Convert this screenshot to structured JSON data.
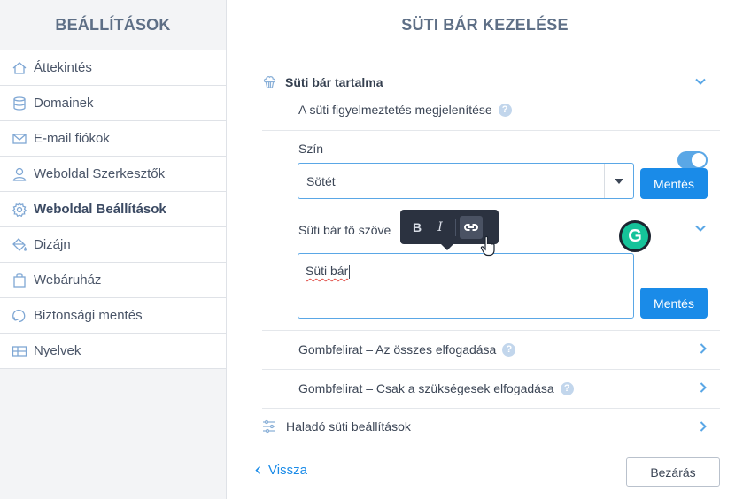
{
  "sidebar": {
    "title": "BEÁLLÍTÁSOK",
    "items": [
      {
        "label": "Áttekintés",
        "icon": "home-icon"
      },
      {
        "label": "Domainek",
        "icon": "database-icon"
      },
      {
        "label": "E-mail fiókok",
        "icon": "mail-icon"
      },
      {
        "label": "Weboldal Szerkesztők",
        "icon": "user-icon"
      },
      {
        "label": "Weboldal Beállítások",
        "icon": "gear-icon",
        "active": true
      },
      {
        "label": "Dizájn",
        "icon": "paint-bucket-icon"
      },
      {
        "label": "Webáruház",
        "icon": "shopping-bag-icon"
      },
      {
        "label": "Biztonsági mentés",
        "icon": "backup-icon"
      },
      {
        "label": "Nyelvek",
        "icon": "flag-icon"
      }
    ]
  },
  "main": {
    "title": "SÜTI BÁR KEZELÉSE",
    "section_title": "Süti bár tartalma",
    "show_warning_label": "A süti figyelmeztetés megjelenítése",
    "show_warning_enabled": true,
    "color_label": "Szín",
    "color_value": "Sötét",
    "save_label": "Mentés",
    "main_text_label": "Süti bár fő szöve",
    "main_text_value": "Süti bár",
    "toolbar": {
      "bold": "B",
      "italic": "I"
    },
    "grammarly_letter": "G",
    "button_accept_all_label": "Gombfelirat – Az összes elfogadása",
    "button_necessary_label": "Gombfelirat – Csak a szükségesek elfogadása",
    "advanced_label": "Haladó süti beállítások",
    "help_glyph": "?",
    "back_label": "Vissza",
    "close_label": "Bezárás"
  },
  "colors": {
    "accent": "#1a8be8",
    "toggle": "#5aa7e6",
    "grammarly": "#15c39a"
  }
}
